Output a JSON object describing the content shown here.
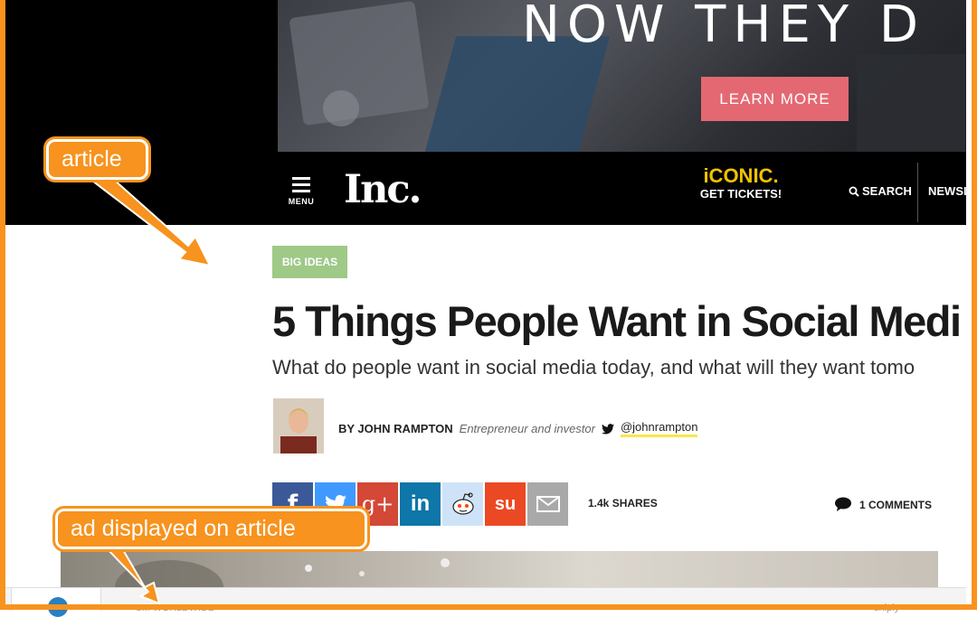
{
  "banner_ad": {
    "headline": "NOW THEY D",
    "cta_label": "LEARN MORE"
  },
  "site_header": {
    "menu_label": "MENU",
    "logo": "Inc.",
    "promo_title": "iCONIC.",
    "promo_subtitle": "GET TICKETS!",
    "search_label": "SEARCH",
    "newsletter_label": "NEWSL"
  },
  "article": {
    "category": "BIG IDEAS",
    "headline": "5 Things People Want in Social Medi",
    "subhead": "What do people want in social media today, and what will they want tomo",
    "author": {
      "name": "BY JOHN RAMPTON",
      "role": "Entrepreneur and investor",
      "twitter": "@johnrampton"
    },
    "share_buttons": [
      {
        "network": "facebook",
        "glyph": "f",
        "color": "#3b5998"
      },
      {
        "network": "twitter",
        "glyph": "t",
        "color": "#4099ff"
      },
      {
        "network": "google-plus",
        "glyph": "g+",
        "color": "#d34836"
      },
      {
        "network": "linkedin",
        "glyph": "in",
        "color": "#0e76a8"
      },
      {
        "network": "reddit",
        "glyph": "r",
        "color": "#cee3f8"
      },
      {
        "network": "stumbleupon",
        "glyph": "su",
        "color": "#eb4924"
      },
      {
        "network": "email",
        "glyph": "✉",
        "color": "#a9a9a9"
      }
    ],
    "shares_count": "1.4k SHARES",
    "comments_count": "1 COMMENTS"
  },
  "bottom_ad": {
    "sponsor": "SM WORLDWIDE",
    "brand": "sniply"
  },
  "callouts": {
    "article": "article",
    "ad": "ad displayed on article"
  }
}
